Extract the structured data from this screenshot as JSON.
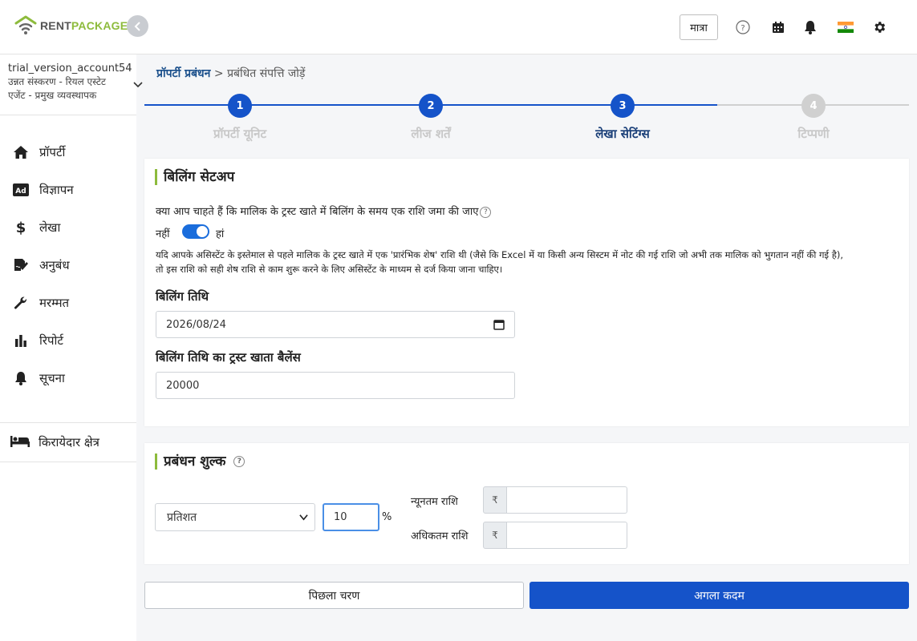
{
  "header": {
    "logo_rent": "RENT",
    "logo_package": "PACKAGE",
    "lang_button": "मात्रा"
  },
  "account": {
    "name": "trial_version_account54",
    "role": "उन्नत संस्करण - रियल एस्टेट एजेंट - प्रमुख व्यवस्थापक"
  },
  "sidebar": {
    "items": [
      {
        "label": "प्रॉपर्टी",
        "icon": "home-icon"
      },
      {
        "label": "विज्ञापन",
        "icon": "ad-icon"
      },
      {
        "label": "लेखा",
        "icon": "dollar-icon"
      },
      {
        "label": "अनुबंध",
        "icon": "contract-icon"
      },
      {
        "label": "मरम्मत",
        "icon": "wrench-icon"
      },
      {
        "label": "रिपोर्ट",
        "icon": "bar-chart-icon"
      },
      {
        "label": "सूचना",
        "icon": "bell-icon"
      }
    ],
    "tenant_area": "किरायेदार क्षेत्र"
  },
  "breadcrumb": {
    "link": "प्रॉपर्टी प्रबंधन",
    "separator": ">",
    "current": "प्रबंधित संपत्ति जोड़ें"
  },
  "stepper": {
    "steps": [
      {
        "number": "1",
        "label": "प्रॉपर्टी यूनिट",
        "state": "done"
      },
      {
        "number": "2",
        "label": "लीज शर्तें",
        "state": "done"
      },
      {
        "number": "3",
        "label": "लेखा सेटिंग्स",
        "state": "active"
      },
      {
        "number": "4",
        "label": "टिप्पणी",
        "state": "pending"
      }
    ]
  },
  "billing": {
    "title": "बिलिंग सेटअप",
    "question": "क्या आप चाहते हैं कि मालिक के ट्रस्ट खाते में बिलिंग के समय एक राशि जमा की जाए",
    "toggle_no": "नहीं",
    "toggle_yes": "हां",
    "toggle_on": true,
    "note_line1": "यदि आपके असिस्टेंट के इस्तेमाल से पहले मालिक के ट्रस्ट खाते में एक 'प्रारंभिक शेष' राशि थी (जैसे कि Excel में या किसी अन्य सिस्टम में नोट की गई राशि जो अभी तक मालिक को भुगतान नहीं की गई है),",
    "note_line2": "तो इस राशि को सही शेष राशि से काम शुरू करने के लिए असिस्टेंट के माध्यम से दर्ज किया जाना चाहिए।",
    "date_label": "बिलिंग तिथि",
    "date_value": "2026/08/24",
    "balance_label": "बिलिंग तिथि का ट्रस्ट खाता बैलेंस",
    "balance_value": "20000"
  },
  "management_fee": {
    "title": "प्रबंधन शुल्क",
    "type_selected": "प्रतिशत",
    "percent_value": "10",
    "percent_sign": "%",
    "min_label": "न्यूनतम राशि",
    "max_label": "अधिकतम राशि",
    "currency_symbol": "₹"
  },
  "footer": {
    "prev_label": "पिछला चरण",
    "next_label": "अगला कदम"
  },
  "colors": {
    "accent_blue": "#1553c9",
    "brand_green": "#8dbb3c",
    "pending_gray": "#d0d0d0"
  }
}
